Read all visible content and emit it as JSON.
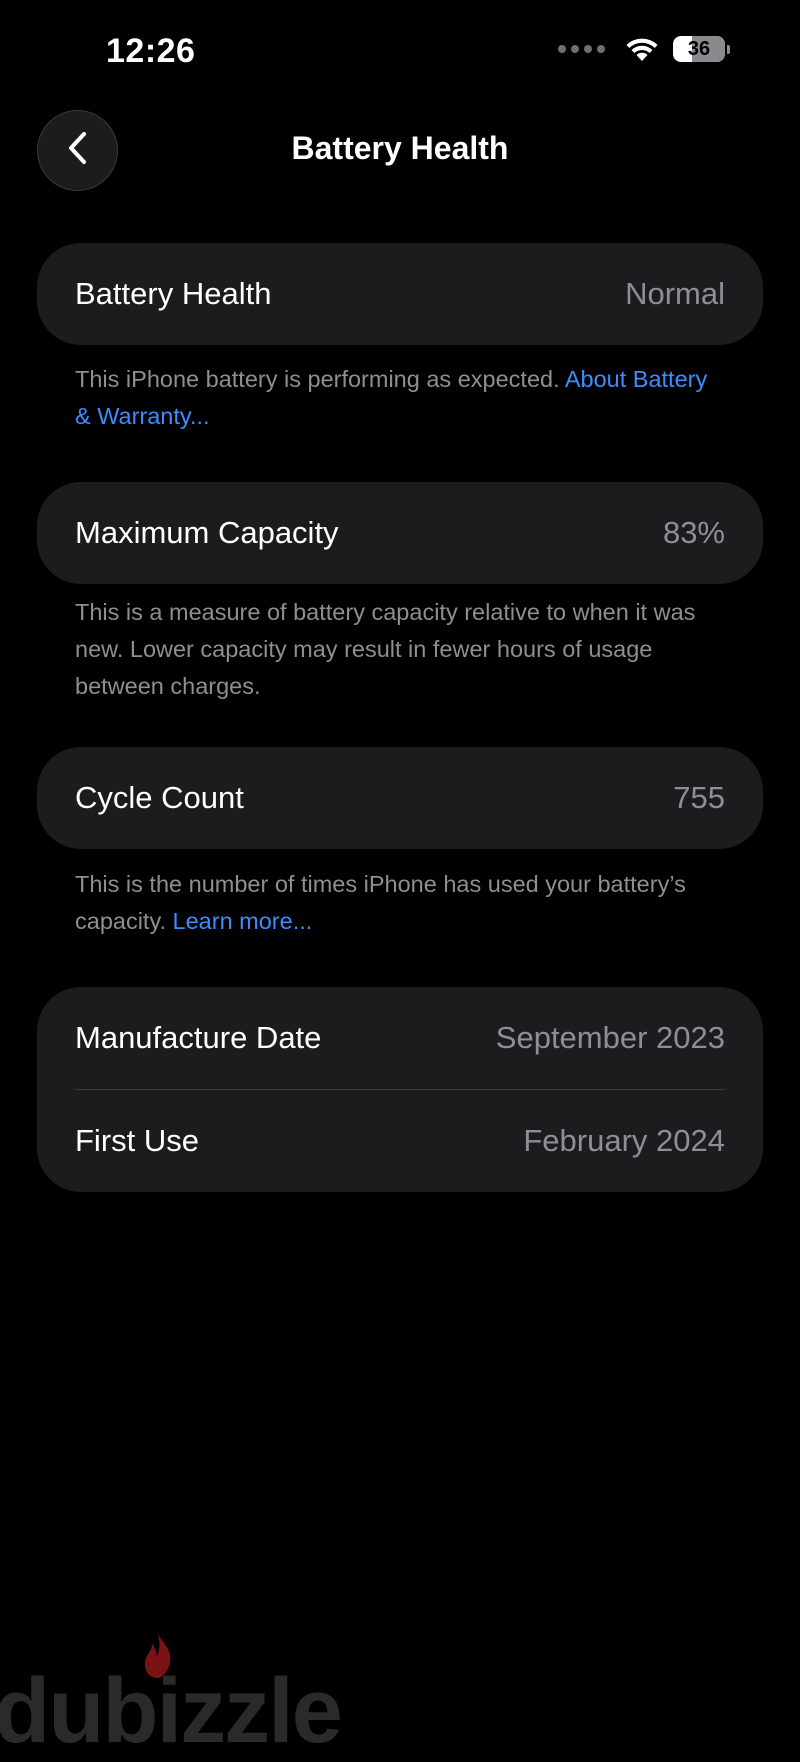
{
  "status_bar": {
    "time": "12:26",
    "battery_percent": "36",
    "battery_level": 0.36,
    "wifi_icon": "wifi-icon",
    "signal_icon": "signal-dots-icon"
  },
  "nav": {
    "back_icon": "chevron-left-icon",
    "title": "Battery Health"
  },
  "battery_health": {
    "label": "Battery Health",
    "value": "Normal",
    "footnote_text": "This iPhone battery is performing as expected. ",
    "footnote_link": "About Battery & Warranty..."
  },
  "maximum_capacity": {
    "label": "Maximum Capacity",
    "value": "83%",
    "footnote_text": "This is a measure of battery capacity relative to when it was new. Lower capacity may result in fewer hours of usage between charges."
  },
  "cycle_count": {
    "label": "Cycle Count",
    "value": "755",
    "footnote_text": "This is the number of times iPhone has used your battery’s capacity. ",
    "footnote_link": "Learn more..."
  },
  "dates": {
    "manufacture_label": "Manufacture Date",
    "manufacture_value": "September 2023",
    "first_use_label": "First Use",
    "first_use_value": "February 2024"
  },
  "watermark": {
    "text": "dubizzle"
  },
  "colors": {
    "background": "#000000",
    "card": "#1c1c1e",
    "secondary_text": "#8e8e93",
    "link": "#3d8cff",
    "watermark_flame": "#8b1a1a"
  }
}
